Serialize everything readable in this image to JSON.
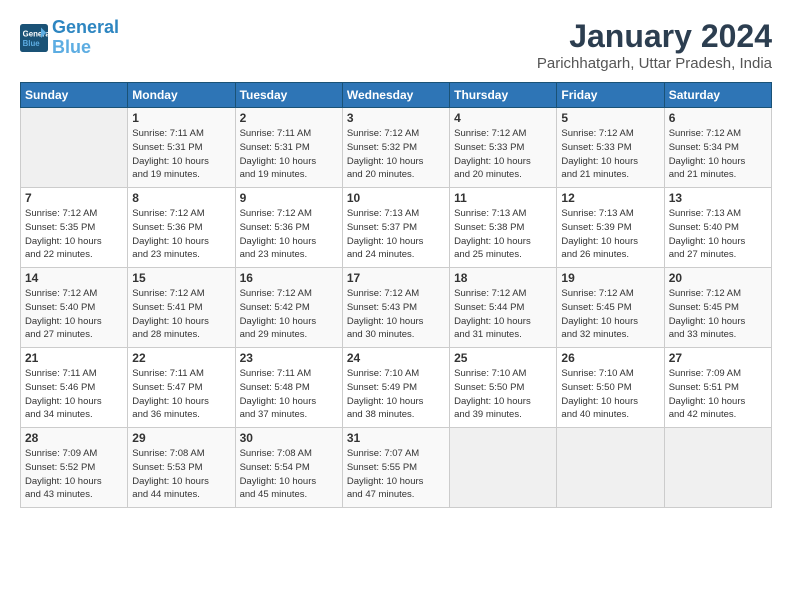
{
  "header": {
    "logo_line1": "General",
    "logo_line2": "Blue",
    "month": "January 2024",
    "location": "Parichhatgarh, Uttar Pradesh, India"
  },
  "weekdays": [
    "Sunday",
    "Monday",
    "Tuesday",
    "Wednesday",
    "Thursday",
    "Friday",
    "Saturday"
  ],
  "weeks": [
    [
      {
        "day": "",
        "info": ""
      },
      {
        "day": "1",
        "info": "Sunrise: 7:11 AM\nSunset: 5:31 PM\nDaylight: 10 hours\nand 19 minutes."
      },
      {
        "day": "2",
        "info": "Sunrise: 7:11 AM\nSunset: 5:31 PM\nDaylight: 10 hours\nand 19 minutes."
      },
      {
        "day": "3",
        "info": "Sunrise: 7:12 AM\nSunset: 5:32 PM\nDaylight: 10 hours\nand 20 minutes."
      },
      {
        "day": "4",
        "info": "Sunrise: 7:12 AM\nSunset: 5:33 PM\nDaylight: 10 hours\nand 20 minutes."
      },
      {
        "day": "5",
        "info": "Sunrise: 7:12 AM\nSunset: 5:33 PM\nDaylight: 10 hours\nand 21 minutes."
      },
      {
        "day": "6",
        "info": "Sunrise: 7:12 AM\nSunset: 5:34 PM\nDaylight: 10 hours\nand 21 minutes."
      }
    ],
    [
      {
        "day": "7",
        "info": "Sunrise: 7:12 AM\nSunset: 5:35 PM\nDaylight: 10 hours\nand 22 minutes."
      },
      {
        "day": "8",
        "info": "Sunrise: 7:12 AM\nSunset: 5:36 PM\nDaylight: 10 hours\nand 23 minutes."
      },
      {
        "day": "9",
        "info": "Sunrise: 7:12 AM\nSunset: 5:36 PM\nDaylight: 10 hours\nand 23 minutes."
      },
      {
        "day": "10",
        "info": "Sunrise: 7:13 AM\nSunset: 5:37 PM\nDaylight: 10 hours\nand 24 minutes."
      },
      {
        "day": "11",
        "info": "Sunrise: 7:13 AM\nSunset: 5:38 PM\nDaylight: 10 hours\nand 25 minutes."
      },
      {
        "day": "12",
        "info": "Sunrise: 7:13 AM\nSunset: 5:39 PM\nDaylight: 10 hours\nand 26 minutes."
      },
      {
        "day": "13",
        "info": "Sunrise: 7:13 AM\nSunset: 5:40 PM\nDaylight: 10 hours\nand 27 minutes."
      }
    ],
    [
      {
        "day": "14",
        "info": "Sunrise: 7:12 AM\nSunset: 5:40 PM\nDaylight: 10 hours\nand 27 minutes."
      },
      {
        "day": "15",
        "info": "Sunrise: 7:12 AM\nSunset: 5:41 PM\nDaylight: 10 hours\nand 28 minutes."
      },
      {
        "day": "16",
        "info": "Sunrise: 7:12 AM\nSunset: 5:42 PM\nDaylight: 10 hours\nand 29 minutes."
      },
      {
        "day": "17",
        "info": "Sunrise: 7:12 AM\nSunset: 5:43 PM\nDaylight: 10 hours\nand 30 minutes."
      },
      {
        "day": "18",
        "info": "Sunrise: 7:12 AM\nSunset: 5:44 PM\nDaylight: 10 hours\nand 31 minutes."
      },
      {
        "day": "19",
        "info": "Sunrise: 7:12 AM\nSunset: 5:45 PM\nDaylight: 10 hours\nand 32 minutes."
      },
      {
        "day": "20",
        "info": "Sunrise: 7:12 AM\nSunset: 5:45 PM\nDaylight: 10 hours\nand 33 minutes."
      }
    ],
    [
      {
        "day": "21",
        "info": "Sunrise: 7:11 AM\nSunset: 5:46 PM\nDaylight: 10 hours\nand 34 minutes."
      },
      {
        "day": "22",
        "info": "Sunrise: 7:11 AM\nSunset: 5:47 PM\nDaylight: 10 hours\nand 36 minutes."
      },
      {
        "day": "23",
        "info": "Sunrise: 7:11 AM\nSunset: 5:48 PM\nDaylight: 10 hours\nand 37 minutes."
      },
      {
        "day": "24",
        "info": "Sunrise: 7:10 AM\nSunset: 5:49 PM\nDaylight: 10 hours\nand 38 minutes."
      },
      {
        "day": "25",
        "info": "Sunrise: 7:10 AM\nSunset: 5:50 PM\nDaylight: 10 hours\nand 39 minutes."
      },
      {
        "day": "26",
        "info": "Sunrise: 7:10 AM\nSunset: 5:50 PM\nDaylight: 10 hours\nand 40 minutes."
      },
      {
        "day": "27",
        "info": "Sunrise: 7:09 AM\nSunset: 5:51 PM\nDaylight: 10 hours\nand 42 minutes."
      }
    ],
    [
      {
        "day": "28",
        "info": "Sunrise: 7:09 AM\nSunset: 5:52 PM\nDaylight: 10 hours\nand 43 minutes."
      },
      {
        "day": "29",
        "info": "Sunrise: 7:08 AM\nSunset: 5:53 PM\nDaylight: 10 hours\nand 44 minutes."
      },
      {
        "day": "30",
        "info": "Sunrise: 7:08 AM\nSunset: 5:54 PM\nDaylight: 10 hours\nand 45 minutes."
      },
      {
        "day": "31",
        "info": "Sunrise: 7:07 AM\nSunset: 5:55 PM\nDaylight: 10 hours\nand 47 minutes."
      },
      {
        "day": "",
        "info": ""
      },
      {
        "day": "",
        "info": ""
      },
      {
        "day": "",
        "info": ""
      }
    ]
  ]
}
